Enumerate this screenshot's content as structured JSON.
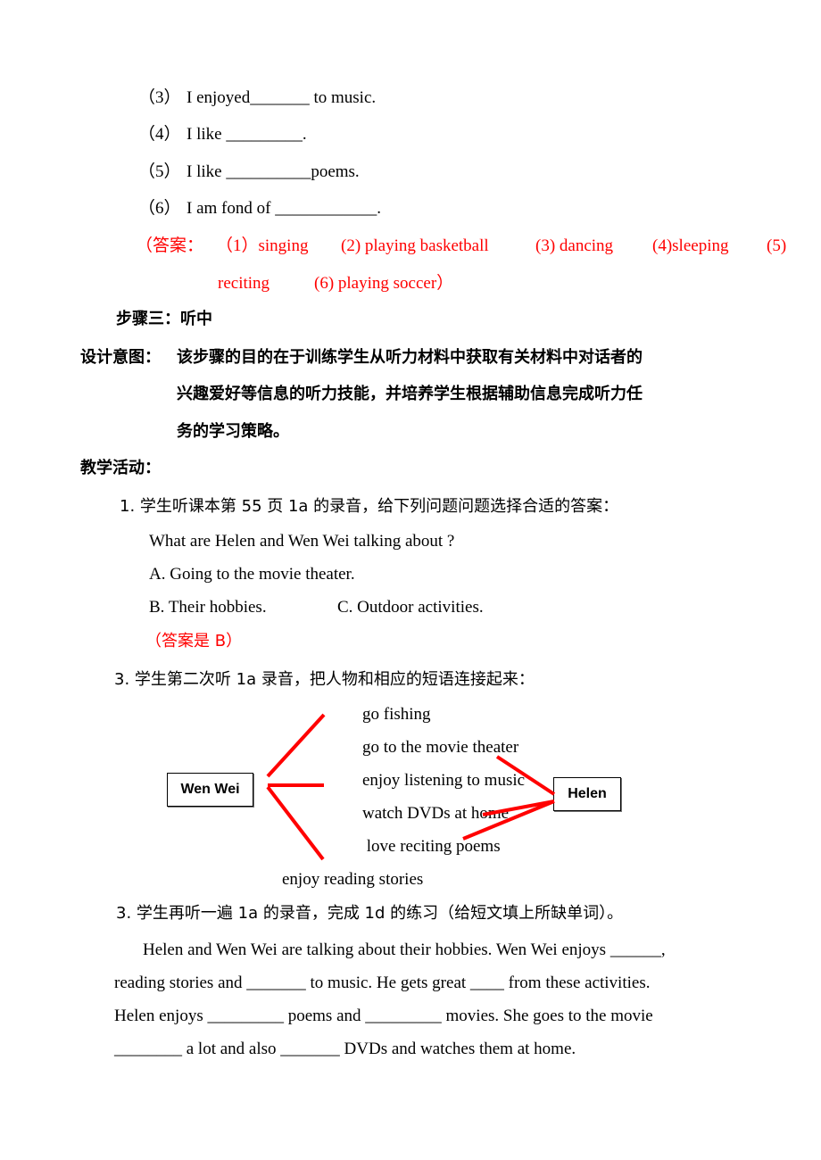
{
  "fill_in_items": [
    {
      "num": "（3）",
      "text": "I enjoyed_______ to music."
    },
    {
      "num": "（4）",
      "text": "I like _________."
    },
    {
      "num": "（5）",
      "text": "I like __________poems."
    },
    {
      "num": "（6）",
      "text": "I am fond of ____________."
    }
  ],
  "answers_block": {
    "prefix": "（答案：",
    "items": [
      "（1）singing",
      "(2) playing basketball",
      "(3) dancing",
      "(4)sleeping",
      "(5)"
    ],
    "line2": [
      "reciting",
      "(6) playing soccer）"
    ]
  },
  "step_three": {
    "title": "步骤三：听中",
    "design_label": "设计意图：",
    "design_lines": [
      "该步骤的目的在于训练学生从听力材料中获取有关材料中对话者的",
      "兴趣爱好等信息的听力技能，并培养学生根据辅助信息完成听力任",
      "务的学习策略。"
    ],
    "activities_label": "教学活动："
  },
  "activity1": {
    "instruction": "1.  学生听课本第 55 页 1a 的录音，给下列问题问题选择合适的答案：",
    "question": "What are Helen and Wen Wei talking about ?",
    "option_a": "A. Going to the movie theater.",
    "option_b": "B. Their hobbies.",
    "option_c": "C. Outdoor activities.",
    "answer": "（答案是 B）"
  },
  "activity2": {
    "instruction": "3.  学生第二次听 1a 录音，把人物和相应的短语连接起来：",
    "left_person": "Wen Wei",
    "right_person": "Helen",
    "phrases": [
      "go fishing",
      "go to the movie theater",
      "enjoy listening to music",
      "watch DVDs at home",
      " love reciting poems",
      "enjoy reading stories"
    ],
    "line_color": "#ff0000",
    "matches": {
      "Wen Wei": [
        "go fishing",
        "enjoy listening to music",
        "enjoy reading stories"
      ],
      "Helen": [
        "go to the movie theater",
        "watch DVDs at home",
        "love reciting poems"
      ]
    }
  },
  "activity3": {
    "instruction": "3.  学生再听一遍 1a 的录音，完成 1d 的练习（给短文填上所缺单词）。",
    "passage_lines": [
      "Helen and Wen Wei are talking about their hobbies. Wen Wei enjoys ______,",
      "reading stories and _______ to music. He gets great ____ from these activities.",
      "Helen enjoys _________ poems and _________ movies. She goes to the movie",
      "________ a lot and also _______ DVDs and watches them at home."
    ]
  }
}
